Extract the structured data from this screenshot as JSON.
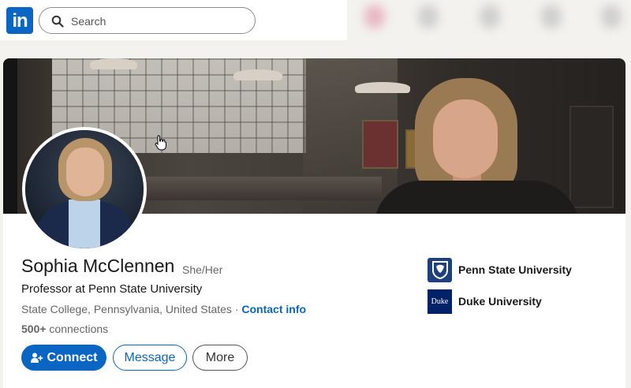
{
  "nav": {
    "logo_text": "in",
    "search_placeholder": "Search"
  },
  "profile": {
    "name": "Sophia McClennen",
    "pronouns": "She/Her",
    "headline": "Professor at Penn State University",
    "location": "State College, Pennsylvania, United States",
    "location_sep": " · ",
    "contact_info": "Contact info",
    "connections_count": "500+",
    "connections_label": " connections"
  },
  "actions": {
    "connect": "Connect",
    "message": "Message",
    "more": "More"
  },
  "education": [
    {
      "name": "Penn State University"
    },
    {
      "name": "Duke University",
      "logo_text": "Duke"
    }
  ],
  "colors": {
    "brand": "#0a66c2",
    "psu": "#1e407c",
    "duke": "#012169"
  }
}
